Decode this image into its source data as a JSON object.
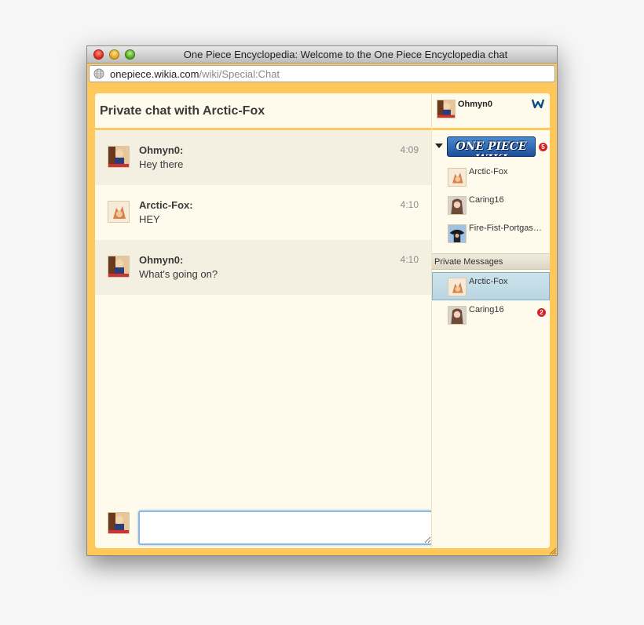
{
  "window": {
    "title": "One Piece Encyclopedia: Welcome to the One Piece Encyclopedia chat",
    "url_host": "onepiece.wikia.com",
    "url_path": "/wiki/Special:Chat"
  },
  "chat": {
    "header_title": "Private chat with Arctic-Fox",
    "messages": [
      {
        "user": "Ohmyn0:",
        "text": "Hey there",
        "time": "4:09",
        "avatar": "ohmyn0-avatar"
      },
      {
        "user": "Arctic-Fox:",
        "text": "HEY",
        "time": "4:10",
        "avatar": "arctic-fox-avatar"
      },
      {
        "user": "Ohmyn0:",
        "text": "What's going on?",
        "time": "4:10",
        "avatar": "ohmyn0-avatar"
      }
    ],
    "compose_placeholder": ""
  },
  "rail": {
    "me": {
      "name": "Ohmyn0",
      "icon": "wikia-icon"
    },
    "room": {
      "logo_text": "ONE PIECE WIKI",
      "badge": "5"
    },
    "users": [
      {
        "name": "Arctic-Fox"
      },
      {
        "name": "Caring16"
      },
      {
        "name": "Fire-Fist-Portgas…"
      }
    ],
    "private_header": "Private Messages",
    "private": [
      {
        "name": "Arctic-Fox",
        "selected": true
      },
      {
        "name": "Caring16",
        "badge": "2"
      }
    ]
  },
  "colors": {
    "frame": "#fec85a",
    "background": "#fffbec",
    "selected": "#c6dfe9",
    "badge": "#d62222"
  }
}
